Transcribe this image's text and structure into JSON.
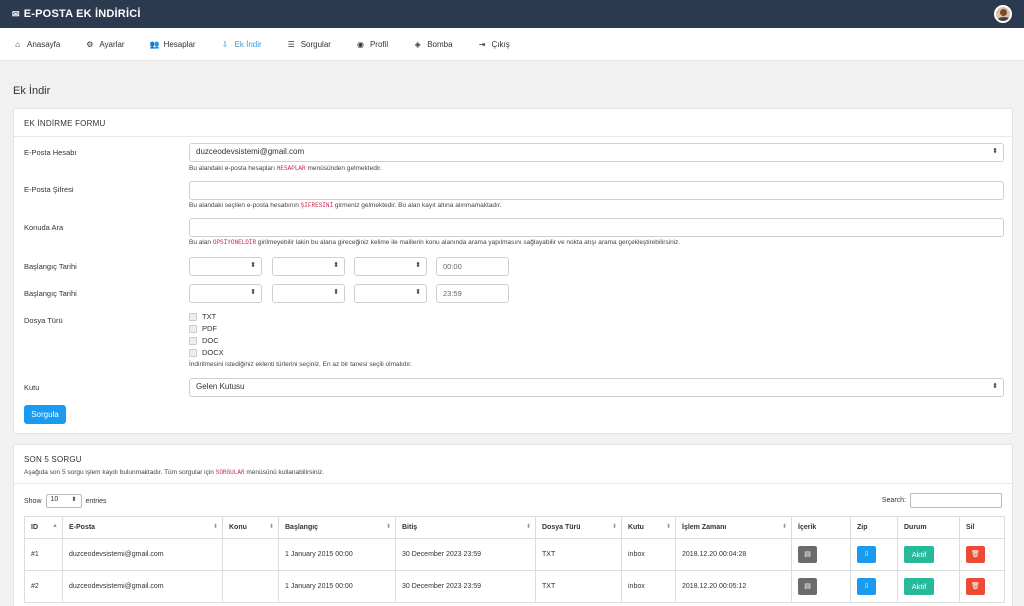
{
  "app": {
    "title": "E-POSTA EK İNDİRİCİ"
  },
  "nav": [
    {
      "label": "Anasayfa",
      "icon": "home-icon",
      "glyph": "⌂"
    },
    {
      "label": "Ayarlar",
      "icon": "gear-icon",
      "glyph": "⚙"
    },
    {
      "label": "Hesaplar",
      "icon": "users-icon",
      "glyph": "👥"
    },
    {
      "label": "Ek İndir",
      "icon": "download-icon",
      "glyph": "⇩"
    },
    {
      "label": "Sorgular",
      "icon": "list-icon",
      "glyph": "☰"
    },
    {
      "label": "Profil",
      "icon": "user-circle-icon",
      "glyph": "◉"
    },
    {
      "label": "Bomba",
      "icon": "bomb-icon",
      "glyph": "◈"
    },
    {
      "label": "Çıkış",
      "icon": "logout-icon",
      "glyph": "⇥"
    }
  ],
  "page": {
    "title": "Ek İndir"
  },
  "form": {
    "heading": "EK İNDİRME FORMU",
    "email_label": "E-Posta Hesabı",
    "email_value": "duzceodevsistemi@gmail.com",
    "email_help_a": "Bu alandaki e-posta hesapları",
    "email_help_code": "HESAPLAR",
    "email_help_b": "menüsünden gelmektedir.",
    "password_label": "E-Posta Şifresi",
    "password_help_a": "Bu alandaki seçilen e-posta hesabının",
    "password_help_code": "ŞİFRESİNİ",
    "password_help_b": "girmeniz gelmektedir. Bu alan kayıt altına alınmamaktadır.",
    "subject_label": "Konuda Ara",
    "subject_help_a": "Bu alan",
    "subject_help_code": "OPSİYONELDİR",
    "subject_help_b": "girilmeyebilir lakin bu alana gireceğiniz kelime ile maillerin konu alanında arama yapılmasını sağlayabilir ve nokta atışı arama gerçekleştirebilirsiniz.",
    "start_label": "Başlangıç Tarihi",
    "start_time": "00:00",
    "end_label": "Başlangıç Tarihi",
    "end_time": "23:59",
    "filetype_label": "Dosya Türü",
    "filetypes": [
      "TXT",
      "PDF",
      "DOC",
      "DOCX"
    ],
    "filetype_help": "İndirilmesini istediğiniz eklenti türlerini seçiniz. En az bir tanesi seçili olmalıdır.",
    "box_label": "Kutu",
    "box_value": "Gelen Kutusu",
    "submit": "Sorgula"
  },
  "recent": {
    "heading": "SON 5 SORGU",
    "desc_a": "Aşağıda son 5 sorgu işlem kaydı bulunmaktadır. Tüm sorgular için",
    "desc_code": "SORGULAR",
    "desc_b": "menüsünü kullanabilirsiniz.",
    "show_label": "Show",
    "show_value": "10",
    "entries_label": "entries",
    "search_label": "Search:",
    "columns": [
      "ID",
      "E-Posta",
      "Konu",
      "Başlangıç",
      "Bitiş",
      "Dosya Türü",
      "Kutu",
      "İşlem Zamanı",
      "İçerik",
      "Zip",
      "Durum",
      "Sil"
    ],
    "rows": [
      [
        "#1",
        "duzceodevsistemi@gmail.com",
        "",
        "1 January 2015 00:00",
        "30 December 2023 23:59",
        "TXT",
        "inbox",
        "2018.12.20 00:04:28"
      ],
      [
        "#2",
        "duzceodevsistemi@gmail.com",
        "",
        "1 January 2015 00:00",
        "30 December 2023 23:59",
        "TXT",
        "inbox",
        "2018.12.20 00:05:12"
      ]
    ],
    "status_label": "Aktif"
  },
  "colors": {
    "topbar": "#2b3a4e",
    "accent": "#1a9af0",
    "active_nav": "#3a9ad9",
    "success": "#26b99a",
    "danger": "#ec4b37"
  }
}
